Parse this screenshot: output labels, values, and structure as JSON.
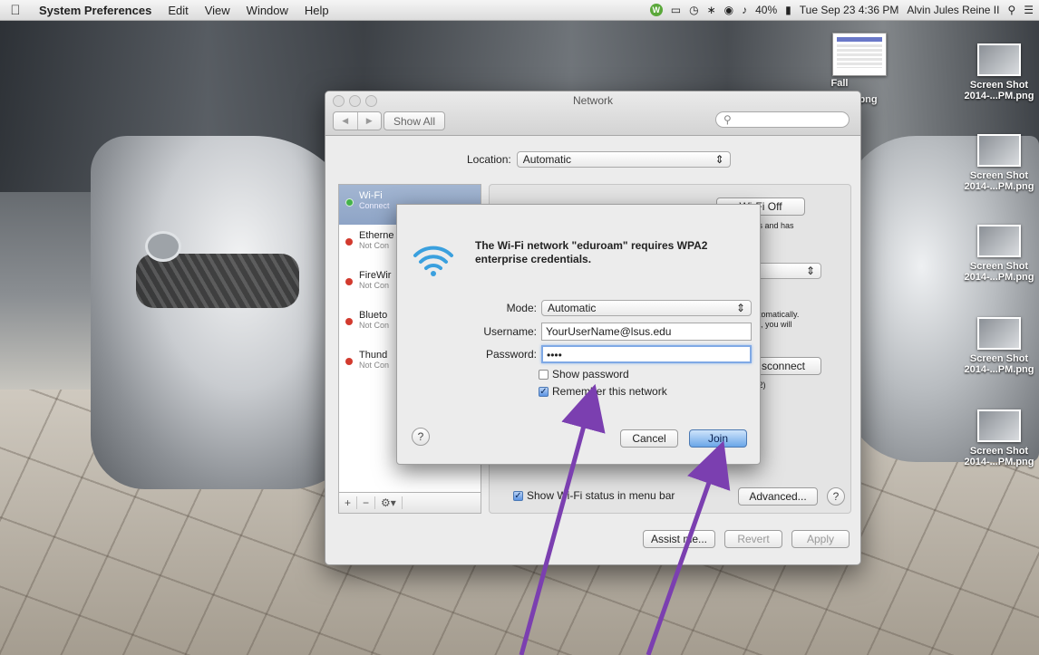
{
  "menubar": {
    "app_name": "System Preferences",
    "menus": [
      "Edit",
      "View",
      "Window",
      "Help"
    ],
    "status_w": "W",
    "battery": "40%",
    "datetime": "Tue Sep 23  4:36 PM",
    "user": "Alvin Jules Reine II"
  },
  "desktop": {
    "doc_label": "Fall",
    "doc_label2": ".png",
    "icons": [
      {
        "line1": "Screen Shot",
        "line2": "2014-...PM.png"
      },
      {
        "line1": "Screen Shot",
        "line2": "2014-...PM.png"
      },
      {
        "line1": "Screen Shot",
        "line2": "2014-...PM.png"
      },
      {
        "line1": "Screen Shot",
        "line2": "2014-...PM.png"
      },
      {
        "line1": "Screen Shot",
        "line2": "2014-...PM.png"
      }
    ]
  },
  "window": {
    "title": "Network",
    "show_all": "Show All",
    "location_label": "Location:",
    "location_value": "Automatic",
    "services": [
      {
        "name": "Wi-Fi",
        "status": "Connect",
        "selected": true
      },
      {
        "name": "Etherne",
        "status": "Not Con"
      },
      {
        "name": "FireWir",
        "status": "Not Con"
      },
      {
        "name": "Blueto",
        "status": "Not Con"
      },
      {
        "name": "Thund",
        "status": "Not Con"
      }
    ],
    "wifi_off_button": "Wi-Fi Off",
    "partial_text_1": "ss and has",
    "partial_text_2": "utomatically.",
    "partial_text_3": "le, you will",
    "partial_text_4": "k.",
    "disconnect_button": "sconnect",
    "partial_text_5": "v2)",
    "show_wifi_status": "Show Wi-Fi status in menu bar",
    "advanced_button": "Advanced...",
    "assist_button": "Assist me...",
    "revert_button": "Revert",
    "apply_button": "Apply"
  },
  "sheet": {
    "message": "The Wi-Fi network \"eduroam\" requires WPA2 enterprise credentials.",
    "mode_label": "Mode:",
    "mode_value": "Automatic",
    "username_label": "Username:",
    "username_value": "YourUserName@lsus.edu",
    "password_label": "Password:",
    "password_value": "••••",
    "show_password": "Show password",
    "remember_network": "Remember this network",
    "cancel_button": "Cancel",
    "join_button": "Join"
  },
  "colors": {
    "arrow": "#7b3fb0",
    "accent": "#5b93e3"
  }
}
